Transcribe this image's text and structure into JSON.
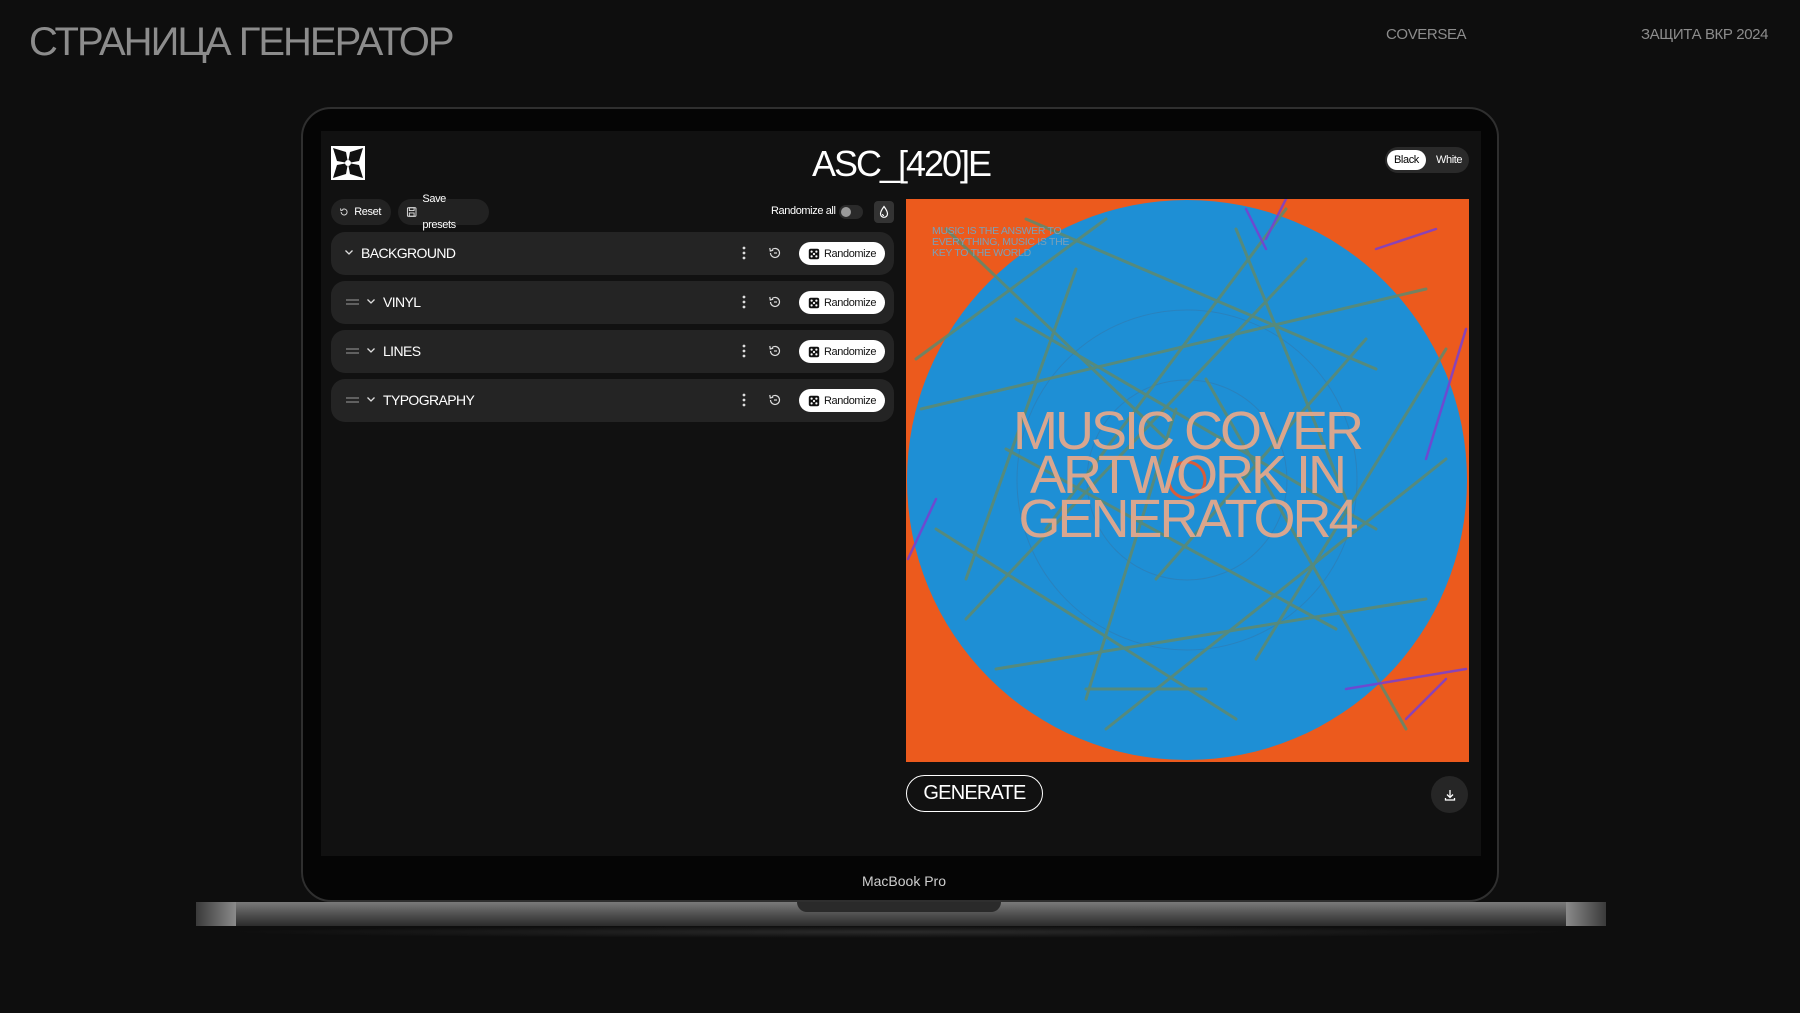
{
  "slide": {
    "title": "СТРАНИЦА ГЕНЕРАТОР",
    "brand": "COVERSEA",
    "defense": "ЗАЩИТА ВКР 2024"
  },
  "device": {
    "label": "MacBook Pro"
  },
  "app": {
    "title": "ASC_[420]E",
    "theme": {
      "options": [
        "Black",
        "White"
      ],
      "selected": "Black"
    },
    "toolbar": {
      "reset_label": "Reset",
      "save_label": "Save presets",
      "randomize_all_label": "Randomize all",
      "randomize_all_on": false
    },
    "layers": [
      {
        "name": "BACKGROUND",
        "randomize_label": "Randomize",
        "draggable": false
      },
      {
        "name": "VINYL",
        "randomize_label": "Randomize",
        "draggable": true
      },
      {
        "name": "LINES",
        "randomize_label": "Randomize",
        "draggable": true
      },
      {
        "name": "TYPOGRAPHY",
        "randomize_label": "Randomize",
        "draggable": true
      }
    ],
    "artwork": {
      "small_text": [
        "MUSIC IS THE ANSWER TO",
        "EVERYTHING, MUSIC IS THE",
        "KEY TO THE WORLD"
      ],
      "headline": [
        "MUSIC COVER",
        "ARTWORK IN",
        "GENERATOR4"
      ],
      "colors": {
        "background": "#ec5a1d",
        "vinyl": "#1e8fd5",
        "lines": "#5f8a6e",
        "accent_lines": "#7a3fd0",
        "text": "#e8a98a"
      }
    },
    "generate_label": "GENERATE"
  },
  "icons": {
    "logo": "abstract-logo-icon",
    "reset": "reset-icon",
    "save": "save-icon",
    "drop": "drop-icon",
    "handle": "drag-handle-icon",
    "chevron": "chevron-down-icon",
    "more": "more-vertical-icon",
    "undo": "undo-icon",
    "dice": "dice-icon",
    "download": "download-icon"
  }
}
